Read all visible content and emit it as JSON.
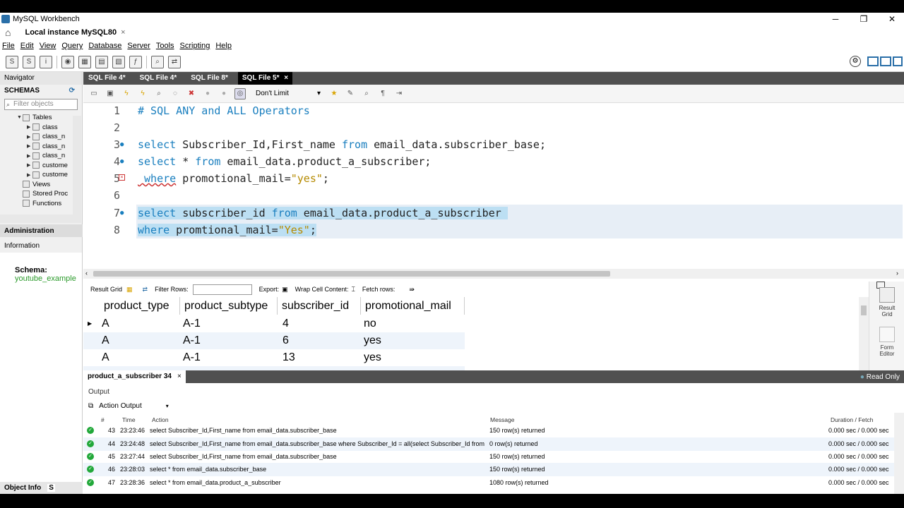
{
  "window": {
    "title": "MySQL Workbench",
    "min": "─",
    "max": "❐",
    "close": "✕"
  },
  "connection_tab": {
    "label": "Local instance MySQL80",
    "close": "×"
  },
  "menu": [
    "File",
    "Edit",
    "View",
    "Query",
    "Database",
    "Server",
    "Tools",
    "Scripting",
    "Help"
  ],
  "navigator": {
    "header": "Navigator",
    "schemas_label": "SCHEMAS",
    "filter_placeholder": "Filter objects",
    "tree": [
      {
        "label": "Tables",
        "level": 0
      },
      {
        "label": "class",
        "level": 1
      },
      {
        "label": "class_n",
        "level": 1
      },
      {
        "label": "class_n",
        "level": 1
      },
      {
        "label": "class_n",
        "level": 1
      },
      {
        "label": "custome",
        "level": 1
      },
      {
        "label": "custome",
        "level": 1
      },
      {
        "label": "Views",
        "level": 0
      },
      {
        "label": "Stored Proc",
        "level": 0
      },
      {
        "label": "Functions",
        "level": 0
      }
    ],
    "admin_tab": "Administration",
    "info_header": "Information",
    "schema_key": "Schema:",
    "schema_value": "youtube_example",
    "object_info_tab": "Object Info",
    "session_tab": "S"
  },
  "sql_tabs": [
    {
      "label": "SQL File 4*",
      "active": false
    },
    {
      "label": "SQL File 4*",
      "active": false
    },
    {
      "label": "SQL File 8*",
      "active": false
    },
    {
      "label": "SQL File 5*",
      "active": true
    }
  ],
  "sql_tab_close": "×",
  "editor_toolbar": {
    "limit": "Don't Limit"
  },
  "editor": {
    "lines": [
      {
        "n": "1",
        "parts": [
          {
            "t": "# SQL ANY and ALL Operators",
            "c": "cm"
          }
        ]
      },
      {
        "n": "2",
        "parts": []
      },
      {
        "n": "3",
        "parts": [
          {
            "t": "select",
            "c": "kw"
          },
          {
            "t": " Subscriber_Id,First_name ",
            "c": ""
          },
          {
            "t": "from",
            "c": "kw"
          },
          {
            "t": " email_data.subscriber_base;",
            "c": ""
          }
        ]
      },
      {
        "n": "4",
        "parts": [
          {
            "t": "select",
            "c": "kw"
          },
          {
            "t": " * ",
            "c": ""
          },
          {
            "t": "from",
            "c": "kw"
          },
          {
            "t": " email_data.product_a_subscriber;",
            "c": ""
          }
        ]
      },
      {
        "n": "5",
        "parts": [
          {
            "t": " where",
            "c": "kw"
          },
          {
            "t": " promotional_mail=",
            "c": ""
          },
          {
            "t": "\"yes\"",
            "c": "str"
          },
          {
            "t": ";",
            "c": ""
          }
        ]
      },
      {
        "n": "6",
        "parts": []
      },
      {
        "n": "7",
        "parts": [
          {
            "t": "select",
            "c": "kw"
          },
          {
            "t": " subscriber_id ",
            "c": ""
          },
          {
            "t": "from",
            "c": "kw"
          },
          {
            "t": " email_data.product_a_subscriber ",
            "c": ""
          }
        ]
      },
      {
        "n": "8",
        "parts": [
          {
            "t": "where",
            "c": "kw"
          },
          {
            "t": " promtional_mail=",
            "c": ""
          },
          {
            "t": "\"Yes\"",
            "c": "str"
          },
          {
            "t": ";",
            "c": ""
          }
        ]
      }
    ]
  },
  "result_toolbar": {
    "result_grid": "Result Grid",
    "filter_rows": "Filter Rows:",
    "export": "Export:",
    "wrap": "Wrap Cell Content:",
    "fetch": "Fetch rows:"
  },
  "grid": {
    "columns": [
      "product_type",
      "product_subtype",
      "subscriber_id",
      "promotional_mail"
    ],
    "rows": [
      [
        "A",
        "A-1",
        "4",
        "no"
      ],
      [
        "A",
        "A-1",
        "6",
        "yes"
      ],
      [
        "A",
        "A-1",
        "13",
        "yes"
      ]
    ]
  },
  "right_panel": {
    "result_grid": "Result Grid",
    "form_editor": "Form Editor"
  },
  "result_tab": {
    "label": "product_a_subscriber 34",
    "close": "×",
    "read_only": "Read Only"
  },
  "output": {
    "title": "Output",
    "selector": "Action Output",
    "columns": {
      "num": "#",
      "time": "Time",
      "action": "Action",
      "message": "Message",
      "duration": "Duration / Fetch"
    },
    "rows": [
      {
        "num": "43",
        "time": "23:23:46",
        "action": "select Subscriber_Id,First_name from email_data.subscriber_base",
        "message": "150 row(s) returned",
        "duration": "0.000 sec / 0.000 sec"
      },
      {
        "num": "44",
        "time": "23:24:48",
        "action": "select Subscriber_Id,First_name from email_data.subscriber_base where Subscriber_Id = all(select Subscriber_Id from ...",
        "message": "0 row(s) returned",
        "duration": "0.000 sec / 0.000 sec"
      },
      {
        "num": "45",
        "time": "23:27:44",
        "action": "select Subscriber_Id,First_name from email_data.subscriber_base",
        "message": "150 row(s) returned",
        "duration": "0.000 sec / 0.000 sec"
      },
      {
        "num": "46",
        "time": "23:28:03",
        "action": "select * from email_data.subscriber_base",
        "message": "150 row(s) returned",
        "duration": "0.000 sec / 0.000 sec"
      },
      {
        "num": "47",
        "time": "23:28:36",
        "action": "select * from email_data.product_a_subscriber",
        "message": "1080 row(s) returned",
        "duration": "0.000 sec / 0.000 sec"
      }
    ]
  }
}
